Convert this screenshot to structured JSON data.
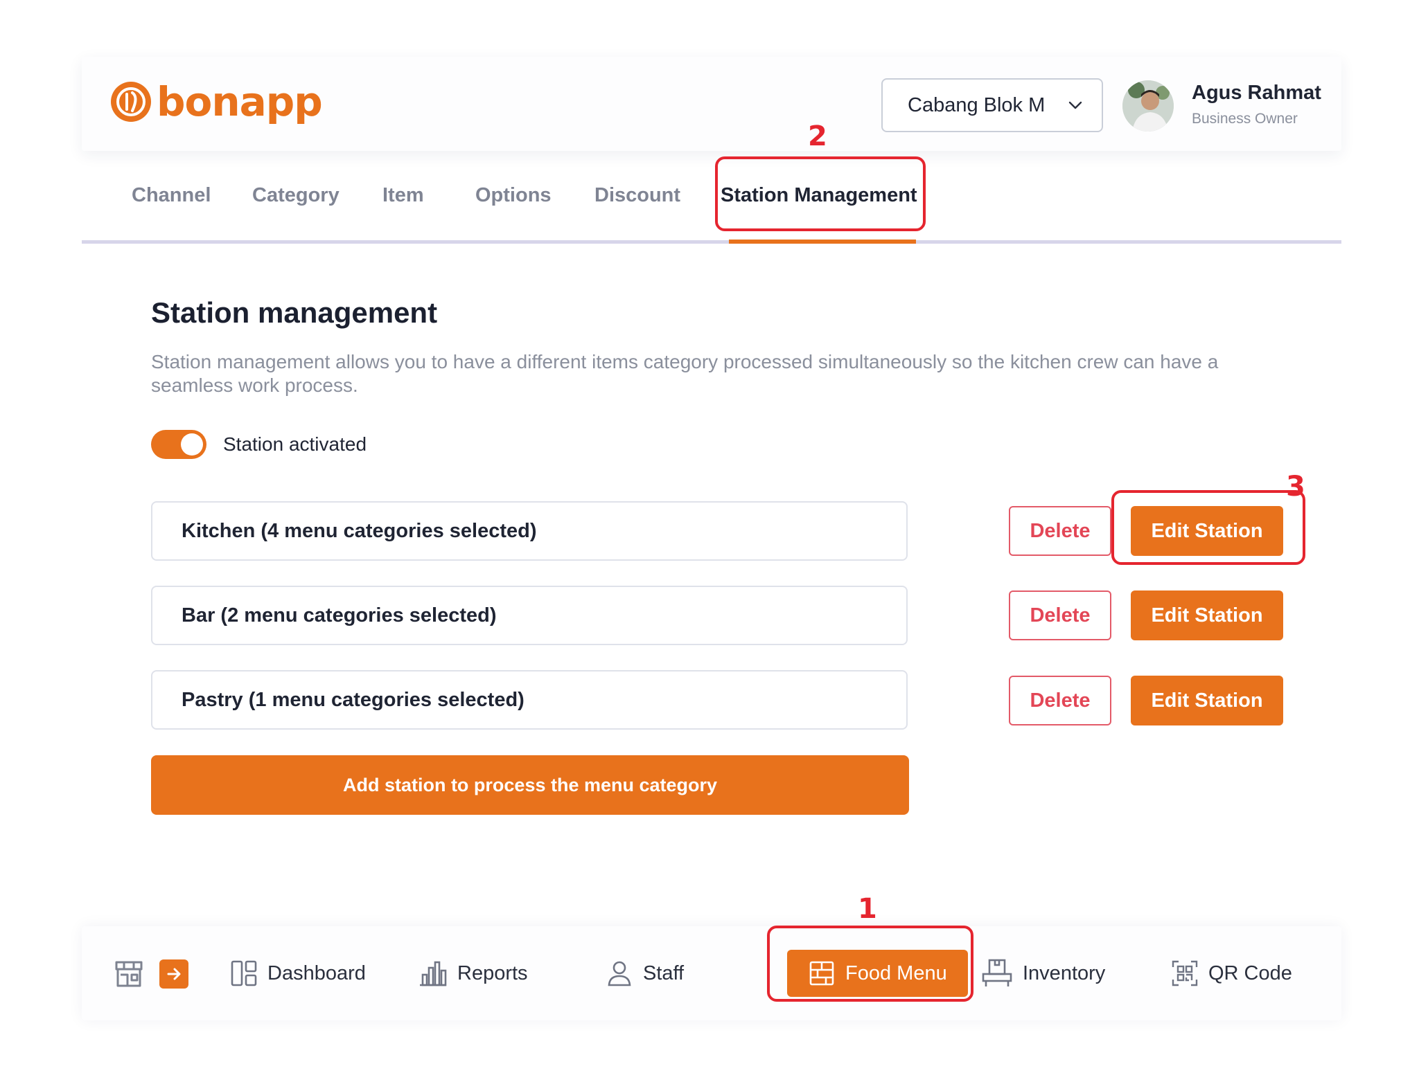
{
  "app": {
    "brand": "bonapp"
  },
  "header": {
    "branch": "Cabang Blok M",
    "user": {
      "name": "Agus Rahmat",
      "role": "Business Owner"
    }
  },
  "tabs": [
    {
      "label": "Channel"
    },
    {
      "label": "Category"
    },
    {
      "label": "Item"
    },
    {
      "label": "Options"
    },
    {
      "label": "Discount"
    },
    {
      "label": "Station Management",
      "active": true
    }
  ],
  "main": {
    "title": "Station management",
    "description": "Station management allows you to have a different items category processed simultaneously so the kitchen crew can have a seamless work process.",
    "toggle": {
      "label": "Station activated",
      "on": true
    },
    "stations": [
      {
        "label": "Kitchen (4 menu categories selected)",
        "delete_label": "Delete",
        "edit_label": "Edit Station"
      },
      {
        "label": "Bar (2 menu categories selected)",
        "delete_label": "Delete",
        "edit_label": "Edit Station"
      },
      {
        "label": "Pastry (1 menu categories selected)",
        "delete_label": "Delete",
        "edit_label": "Edit Station"
      }
    ],
    "add_button": "Add station to process the menu category"
  },
  "bottom_nav": {
    "items": [
      {
        "label": "Dashboard",
        "icon": "dashboard-icon"
      },
      {
        "label": "Reports",
        "icon": "bar-chart-icon"
      },
      {
        "label": "Staff",
        "icon": "user-icon"
      },
      {
        "label": "Food Menu",
        "icon": "food-menu-icon",
        "active": true
      },
      {
        "label": "Inventory",
        "icon": "inventory-icon"
      },
      {
        "label": "QR Code",
        "icon": "qr-code-icon"
      }
    ]
  },
  "annotations": [
    {
      "number": "1",
      "target": "Food Menu"
    },
    {
      "number": "2",
      "target": "Station Management"
    },
    {
      "number": "3",
      "target": "Edit Station"
    }
  ],
  "colors": {
    "accent": "#e8721c",
    "danger": "#e34656",
    "annotation": "#e5252f",
    "muted_text": "#8a8f9c"
  }
}
